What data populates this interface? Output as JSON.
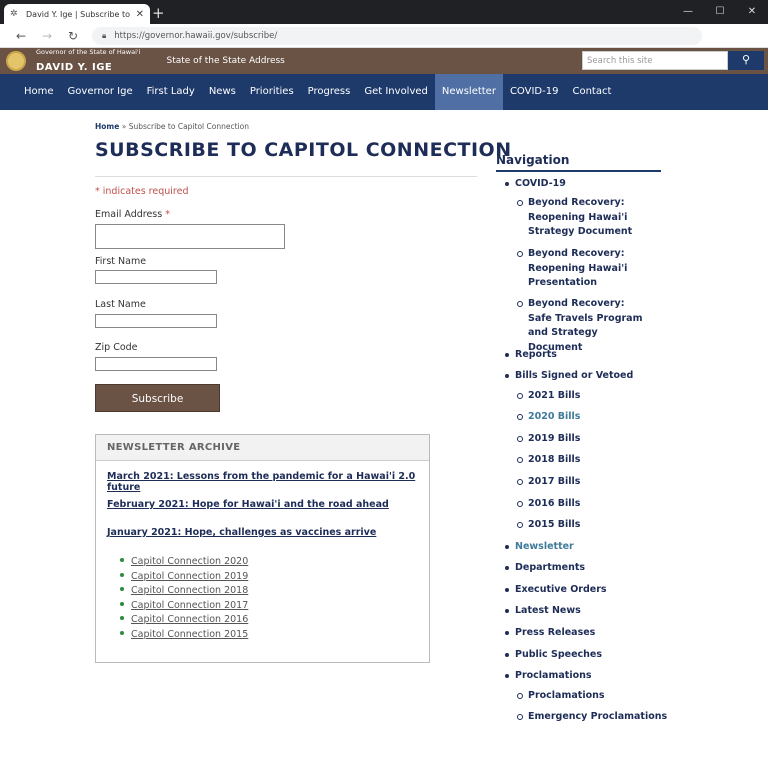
{
  "browser": {
    "tab_title": "David Y. Ige | Subscribe to Capit",
    "url": "https://governor.hawaii.gov/subscribe/"
  },
  "site": {
    "brand_small": "Governor of the State of Hawai'i",
    "brand_name": "DAVID Y. IGE",
    "sosa_link": "State of the State Address",
    "search_placeholder": "Search this site"
  },
  "nav": [
    {
      "label": "Home"
    },
    {
      "label": "Governor Ige"
    },
    {
      "label": "First Lady"
    },
    {
      "label": "News"
    },
    {
      "label": "Priorities"
    },
    {
      "label": "Progress"
    },
    {
      "label": "Get Involved"
    },
    {
      "label": "Newsletter",
      "active": true
    },
    {
      "label": "COVID-19"
    },
    {
      "label": "Contact"
    }
  ],
  "breadcrumb": {
    "home": "Home",
    "sep": " » ",
    "current": "Subscribe to Capitol Connection"
  },
  "page_title": "SUBSCRIBE TO CAPITOL CONNECTION",
  "form": {
    "required_note": "* indicates required",
    "email_label": "Email Address",
    "first_name_label": "First Name",
    "last_name_label": "Last Name",
    "zip_label": "Zip Code",
    "subscribe_label": "Subscribe"
  },
  "archive": {
    "title": "NEWSLETTER ARCHIVE",
    "featured": [
      "March 2021: Lessons from the pandemic for a Hawai'i 2.0 future",
      "February 2021: Hope for Hawai'i and the road ahead",
      "January 2021: Hope, challenges as vaccines arrive"
    ],
    "years": [
      "Capitol Connection 2020",
      "Capitol Connection 2019",
      "Capitol Connection 2018",
      "Capitol Connection 2017",
      "Capitol Connection 2016",
      "Capitol Connection 2015"
    ]
  },
  "sidebar": {
    "title": "Navigation",
    "items": [
      {
        "label": "COVID-19"
      },
      {
        "label": "Beyond Recovery: Reopening Hawai'i Strategy Document"
      },
      {
        "label": "Beyond Recovery: Reopening Hawai'i Presentation"
      },
      {
        "label": "Beyond Recovery: Safe Travels Program and Strategy Document"
      },
      {
        "label": "Reports"
      },
      {
        "label": "Bills Signed or Vetoed"
      },
      {
        "label": "2021 Bills"
      },
      {
        "label": "2020 Bills"
      },
      {
        "label": "2019 Bills"
      },
      {
        "label": "2018 Bills"
      },
      {
        "label": "2017 Bills"
      },
      {
        "label": "2016 Bills"
      },
      {
        "label": "2015 Bills"
      },
      {
        "label": "Newsletter"
      },
      {
        "label": "Departments"
      },
      {
        "label": "Executive Orders"
      },
      {
        "label": "Latest News"
      },
      {
        "label": "Press Releases"
      },
      {
        "label": "Public Speeches"
      },
      {
        "label": "Proclamations"
      },
      {
        "label": "Proclamations"
      },
      {
        "label": "Emergency Proclamations"
      }
    ]
  }
}
